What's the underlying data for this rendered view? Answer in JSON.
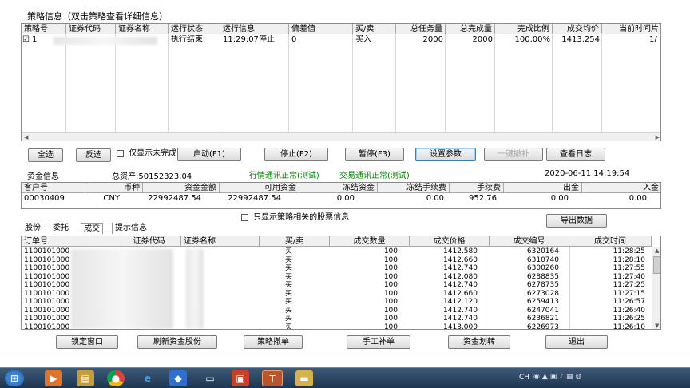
{
  "strategy_panel": {
    "title": "策略信息（双击策略查看详细信息）",
    "columns": [
      "策略号",
      "证券代码",
      "证券名称",
      "运行状态",
      "运行信息",
      "偏差值",
      "买/卖",
      "总任务量",
      "总完成量",
      "完成比例",
      "成交均价",
      "当前时间片"
    ],
    "row": {
      "checkbox": "☑",
      "strategy_no": "1",
      "status": "执行结束",
      "info": "11:29:07停止",
      "deviation": "0",
      "side": "买入",
      "total_qty": "2000",
      "done_qty": "2000",
      "ratio": "100.00%",
      "avg_price": "1413.254",
      "timeslice": "1/"
    }
  },
  "toolbar": {
    "select_all": "全选",
    "invert": "反选",
    "only_unfinished": "仅显示未完成",
    "start": "启动(F1)",
    "stop": "停止(F2)",
    "pause": "暂停(F3)",
    "set_params": "设置参数",
    "one_key_cancel": "一键撤补",
    "view_log": "查看日志"
  },
  "fund_info": {
    "label": "资金信息",
    "total_assets": "总资产:50152323.04",
    "market_status": "行情通讯正常(测试)",
    "trade_status": "交易通讯正常(测试)",
    "datetime": "2020-06-11 14:19:54",
    "columns": [
      "客户号",
      "币种",
      "资金金额",
      "可用资金",
      "冻结资金",
      "冻结手续费",
      "手续费",
      "出金",
      "入金"
    ],
    "row": [
      "00030409",
      "CNY",
      "22992487.54",
      "22992487.54",
      "0.00",
      "0.00",
      "952.76",
      "0.00",
      "0.00"
    ]
  },
  "tabs": [
    "股份",
    "委托",
    "成交",
    "提示信息"
  ],
  "only_strategy_stocks": "只显示策略相关的股票信息",
  "export_button": "导出数据",
  "trades": {
    "columns": [
      "订单号",
      "证券代码",
      "证券名称",
      "买/卖",
      "成交数量",
      "成交价格",
      "成交编号",
      "成交时间"
    ],
    "rows": [
      {
        "order": "11001010000",
        "side": "买",
        "qty": "100",
        "price": "1412.580",
        "no": "6320164",
        "time": "11:28:25"
      },
      {
        "order": "11001010000",
        "side": "买",
        "qty": "100",
        "price": "1412.660",
        "no": "6310740",
        "time": "11:28:10"
      },
      {
        "order": "11001010000",
        "side": "买",
        "qty": "100",
        "price": "1412.740",
        "no": "6300260",
        "time": "11:27:55"
      },
      {
        "order": "11001010000",
        "side": "买",
        "qty": "100",
        "price": "1412.080",
        "no": "6288835",
        "time": "11:27:40"
      },
      {
        "order": "11001010000",
        "side": "买",
        "qty": "100",
        "price": "1412.740",
        "no": "6278735",
        "time": "11:27:25"
      },
      {
        "order": "11001010000",
        "side": "买",
        "qty": "100",
        "price": "1412.660",
        "no": "6273028",
        "time": "11:27:15"
      },
      {
        "order": "11001010000",
        "side": "买",
        "qty": "100",
        "price": "1412.120",
        "no": "6259413",
        "time": "11:26:57"
      },
      {
        "order": "11001010000",
        "side": "买",
        "qty": "100",
        "price": "1412.740",
        "no": "6247041",
        "time": "11:26:40"
      },
      {
        "order": "11001010000",
        "side": "买",
        "qty": "100",
        "price": "1412.740",
        "no": "6236821",
        "time": "11:26:25"
      },
      {
        "order": "11001010000",
        "side": "买",
        "qty": "100",
        "price": "1413.000",
        "no": "6226973",
        "time": "11:26:10"
      }
    ]
  },
  "bottom_buttons": [
    "锁定窗口",
    "刷新资金股份",
    "策略撤单",
    "手工补单",
    "资金划转",
    "退出"
  ],
  "taskbar": {
    "icons": [
      "start-orb-icon",
      "media-player-icon",
      "explorer-icon",
      "chrome-icon",
      "ie-icon",
      "app-icon",
      "camera-icon",
      "presentation-icon",
      "trading-app-icon",
      "folder-icon"
    ],
    "tray_text": "CH"
  },
  "colors": {
    "status_green": "#008000",
    "taskbar": "#2a4563",
    "header_bg": "#f0f0f0"
  }
}
